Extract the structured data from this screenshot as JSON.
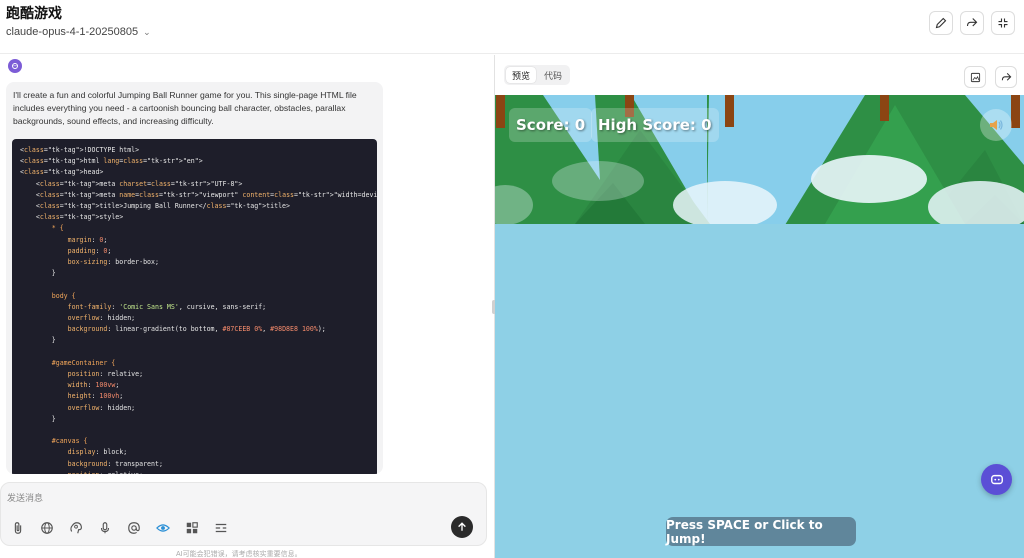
{
  "header": {
    "title": "跑酷游戏",
    "model": "claude-opus-4-1-20250805",
    "buttons": [
      "edit-icon",
      "share-icon",
      "collapse-icon"
    ]
  },
  "chat": {
    "intro": "I'll create a fun and colorful Jumping Ball Runner game for you. This single-page HTML file includes everything you need - a cartoonish bouncing ball character, obstacles, parallax backgrounds, sound effects, and increasing difficulty.",
    "code_lines": [
      "<!DOCTYPE html>",
      "<html lang=\"en\">",
      "<head>",
      "    <meta charset=\"UTF-8\">",
      "    <meta name=\"viewport\" content=\"width=device-width, initial-scale=1.0\">",
      "    <title>Jumping Ball Runner</title>",
      "    <style>",
      "        * {",
      "            margin: 0;",
      "            padding: 0;",
      "            box-sizing: border-box;",
      "        }",
      "",
      "        body {",
      "            font-family: 'Comic Sans MS', cursive, sans-serif;",
      "            overflow: hidden;",
      "            background: linear-gradient(to bottom, #87CEEB 0%, #98D8E8 100%);",
      "        }",
      "",
      "        #gameContainer {",
      "            position: relative;",
      "            width: 100vw;",
      "            height: 100vh;",
      "            overflow: hidden;",
      "        }",
      "",
      "        #canvas {",
      "            display: block;",
      "            background: transparent;",
      "            position: relative;"
    ]
  },
  "composer": {
    "placeholder": "发送消息",
    "tools": [
      "attach-icon",
      "globe-icon",
      "brain-icon",
      "mic-icon",
      "at-icon",
      "eye-icon",
      "apps-icon",
      "list-icon"
    ],
    "disclaimer": "AI可能会犯错误，请考虑核实重要信息。"
  },
  "preview": {
    "tabs": [
      {
        "label": "预览",
        "active": true
      },
      {
        "label": "代码",
        "active": false
      }
    ]
  },
  "game": {
    "score_label": "Score: 0",
    "high_score_label": "High Score: 0",
    "prompt": "Press SPACE or Click to Jump!",
    "colors": {
      "sky_top": "#87CEEB",
      "sky_bottom": "#98D8E8",
      "hill": "#2e8f45",
      "trunk": "#8b4513"
    }
  }
}
